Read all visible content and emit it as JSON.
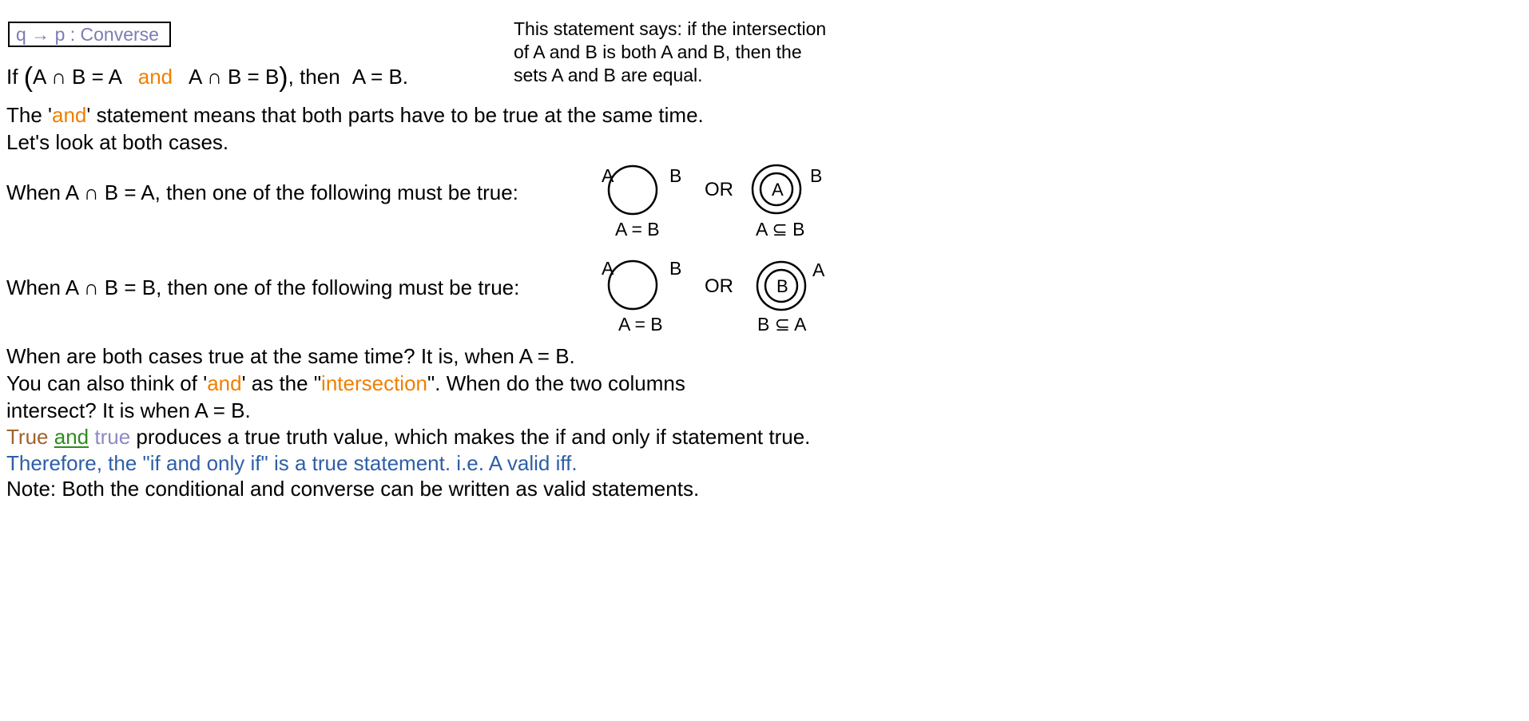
{
  "header": {
    "converse_label": "q → p :  Converse",
    "note": [
      "This statement says: if the intersection",
      "of A and B is both A and B, then the",
      "sets A and B are equal."
    ]
  },
  "statement": {
    "if": "If",
    "open_paren": "(",
    "part1": "A ∩ B = A",
    "and": "and",
    "part2": "A ∩ B = B",
    "close_paren": ")",
    "then": ", then",
    "conclusion": "A = B."
  },
  "explanation": {
    "line1_prefix": "The '",
    "line1_and": "and",
    "line1_suffix": "' statement means that both parts have to be true at the same time.",
    "line2": "Let's look at both cases."
  },
  "case1": {
    "text": "When A ∩ B = A, then one of the following must be true:",
    "or": "OR",
    "diagram1": {
      "label_left": "A",
      "label_right": "B",
      "caption": "A = B"
    },
    "diagram2": {
      "inner": "A",
      "outer": "B",
      "caption": "A ⊆ B"
    }
  },
  "case2": {
    "text": "When A ∩ B = B, then one of the following must be true:",
    "or": "OR",
    "diagram1": {
      "label_left": "A",
      "label_right": "B",
      "caption": "A = B"
    },
    "diagram2": {
      "inner": "B",
      "outer": "A",
      "caption": "B ⊆ A"
    }
  },
  "conclusion": {
    "line1": "When are both cases true at the same time?  It is, when A = B.",
    "line2_prefix": "You can also think of '",
    "line2_and": "and",
    "line2_mid": "' as the \"",
    "line2_intersection": "intersection",
    "line2_suffix": "\".  When do the two columns",
    "line3": "intersect?  It is when A = B.",
    "line4_true1": "True",
    "line4_and": "and",
    "line4_true2": "true",
    "line4_rest": "produces a true truth value, which makes the if and only if statement true.",
    "line5": "Therefore, the \"if and only if\" is a true statement.  i.e. A valid iff.",
    "line6": "Note:  Both the conditional and converse can be written as valid statements."
  },
  "colors": {
    "converse_label": "#7c7cb5",
    "orange": "#f07f00",
    "brown_true": "#a0632c",
    "green_and": "#2e8b1e",
    "lavender_true": "#8a8ac3",
    "blue_therefore": "#2e5ea8"
  }
}
